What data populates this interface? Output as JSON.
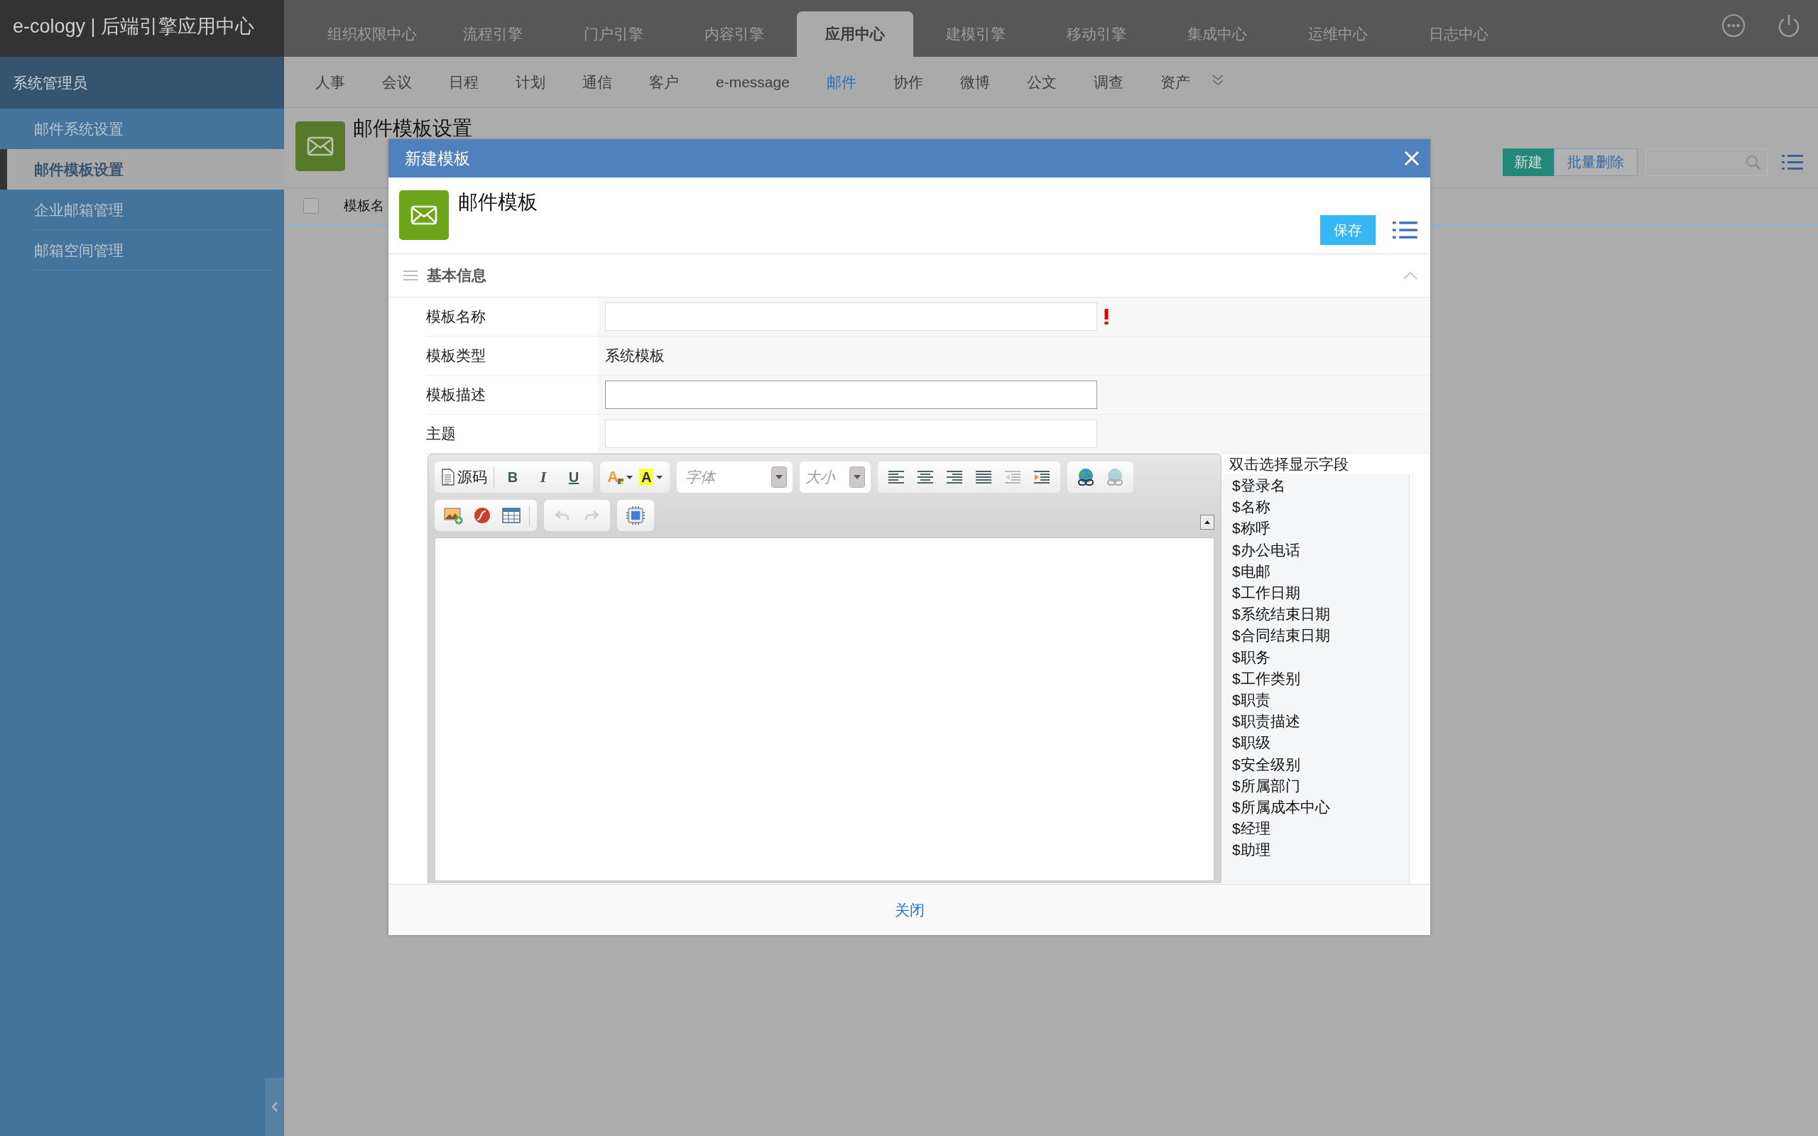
{
  "app": {
    "title": "e-cology | 后端引擎应用中心"
  },
  "top_nav": {
    "tabs": [
      {
        "label": "组织权限中心",
        "selected": false
      },
      {
        "label": "流程引擎",
        "selected": false
      },
      {
        "label": "门户引擎",
        "selected": false
      },
      {
        "label": "内容引擎",
        "selected": false
      },
      {
        "label": "应用中心",
        "selected": true
      },
      {
        "label": "建模引擎",
        "selected": false
      },
      {
        "label": "移动引擎",
        "selected": false
      },
      {
        "label": "集成中心",
        "selected": false
      },
      {
        "label": "运维中心",
        "selected": false
      },
      {
        "label": "日志中心",
        "selected": false
      }
    ]
  },
  "sub_nav": {
    "items": [
      {
        "label": "人事",
        "selected": false
      },
      {
        "label": "会议",
        "selected": false
      },
      {
        "label": "日程",
        "selected": false
      },
      {
        "label": "计划",
        "selected": false
      },
      {
        "label": "通信",
        "selected": false
      },
      {
        "label": "客户",
        "selected": false
      },
      {
        "label": "e-message",
        "selected": false
      },
      {
        "label": "邮件",
        "selected": true
      },
      {
        "label": "协作",
        "selected": false
      },
      {
        "label": "微博",
        "selected": false
      },
      {
        "label": "公文",
        "selected": false
      },
      {
        "label": "调查",
        "selected": false
      },
      {
        "label": "资产",
        "selected": false
      }
    ]
  },
  "sidebar": {
    "header": "系统管理员",
    "items": [
      {
        "label": "邮件系统设置",
        "selected": false
      },
      {
        "label": "邮件模板设置",
        "selected": true
      },
      {
        "label": "企业邮箱管理",
        "selected": false
      },
      {
        "label": "邮箱空间管理",
        "selected": false
      }
    ]
  },
  "page": {
    "title": "邮件模板设置",
    "buttons": [
      {
        "label": "新建",
        "kind": "primary"
      },
      {
        "label": "批量删除",
        "kind": "secondary"
      }
    ],
    "table": {
      "select_all": {
        "checked": false
      },
      "columns": [
        "模板名"
      ]
    }
  },
  "dialog": {
    "title": "新建模板",
    "heading": "邮件模板",
    "save_button": "保存",
    "section": {
      "title": "基本信息",
      "expanded": true
    },
    "fields": [
      {
        "label": "模板名称",
        "kind": "input",
        "required": true,
        "focused": false
      },
      {
        "label": "模板类型",
        "kind": "text",
        "value": "系统模板"
      },
      {
        "label": "模板描述",
        "kind": "input",
        "required": false,
        "focused": true
      },
      {
        "label": "主题",
        "kind": "input",
        "required": false,
        "focused": false
      }
    ],
    "editor": {
      "toolbar_rows": [
        {
          "groups": [
            {
              "buttons": [
                {
                  "kind": "source",
                  "label": "源码",
                  "disabled": false
                },
                {
                  "kind": "separator"
                },
                {
                  "kind": "bold",
                  "label": "B",
                  "disabled": false
                },
                {
                  "kind": "italic",
                  "label": "I",
                  "disabled": false
                },
                {
                  "kind": "underline",
                  "label": "U",
                  "disabled": false
                }
              ]
            },
            {
              "buttons": [
                {
                  "kind": "font-color",
                  "label": "A",
                  "disabled": false
                },
                {
                  "kind": "highlight",
                  "label": "A",
                  "disabled": false
                }
              ]
            },
            {
              "buttons": [
                {
                  "kind": "font-select",
                  "placeholder": "字体"
                }
              ]
            },
            {
              "buttons": [
                {
                  "kind": "size-select",
                  "placeholder": "大小"
                }
              ]
            },
            {
              "buttons": [
                {
                  "kind": "align-left",
                  "disabled": false
                },
                {
                  "kind": "align-center",
                  "disabled": false
                },
                {
                  "kind": "align-right",
                  "disabled": false
                },
                {
                  "kind": "justify",
                  "disabled": false
                },
                {
                  "kind": "outdent",
                  "disabled": true
                },
                {
                  "kind": "indent",
                  "disabled": false
                }
              ]
            },
            {
              "buttons": [
                {
                  "kind": "link",
                  "disabled": false
                },
                {
                  "kind": "unlink",
                  "disabled": true
                }
              ]
            }
          ]
        },
        {
          "groups": [
            {
              "buttons": [
                {
                  "kind": "image",
                  "disabled": false
                },
                {
                  "kind": "flash",
                  "disabled": false
                },
                {
                  "kind": "table",
                  "disabled": false
                },
                {
                  "kind": "separator"
                }
              ]
            },
            {
              "buttons": [
                {
                  "kind": "undo",
                  "disabled": true
                },
                {
                  "kind": "redo",
                  "disabled": true
                }
              ]
            },
            {
              "buttons": [
                {
                  "kind": "maximize",
                  "disabled": false
                }
              ]
            }
          ]
        }
      ]
    },
    "field_picker": {
      "title": "双击选择显示字段",
      "items": [
        "$登录名",
        "$名称",
        "$称呼",
        "$办公电话",
        "$电邮",
        "$工作日期",
        "$系统结束日期",
        "$合同结束日期",
        "$职务",
        "$工作类别",
        "$职责",
        "$职责描述",
        "$职级",
        "$安全级别",
        "$所属部门",
        "$所属成本中心",
        "$经理",
        "$助理"
      ]
    },
    "close_button": "关闭"
  }
}
